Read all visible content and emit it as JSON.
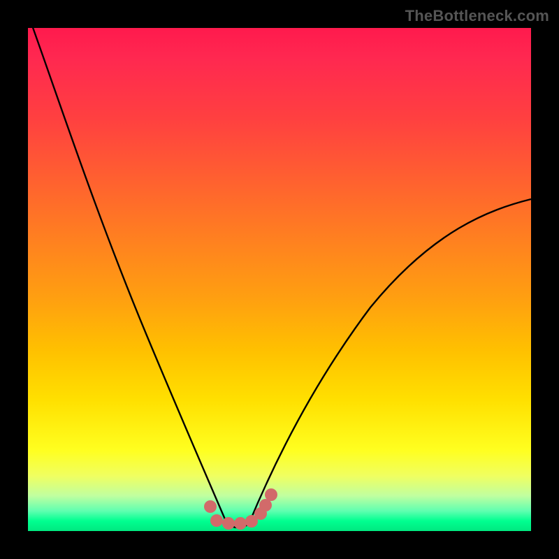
{
  "watermark": "TheBottleneck.com",
  "chart_data": {
    "type": "line",
    "title": "",
    "xlabel": "",
    "ylabel": "",
    "xlim": [
      0,
      100
    ],
    "ylim": [
      0,
      100
    ],
    "series": [
      {
        "name": "curve-left",
        "x": [
          0,
          5,
          10,
          15,
          20,
          25,
          30,
          33,
          36,
          38,
          40
        ],
        "y": [
          100,
          85,
          70,
          56,
          42,
          29,
          17,
          10,
          5,
          2,
          0
        ]
      },
      {
        "name": "curve-right",
        "x": [
          44,
          47,
          50,
          54,
          60,
          68,
          78,
          90,
          100
        ],
        "y": [
          0,
          3,
          7,
          12,
          21,
          33,
          46,
          58,
          66
        ]
      }
    ],
    "markers": {
      "name": "bottom-dots",
      "color": "#d26a6a",
      "points": [
        {
          "x": 36.3,
          "y": 4.8
        },
        {
          "x": 37.5,
          "y": 2.0
        },
        {
          "x": 39.8,
          "y": 1.6
        },
        {
          "x": 42.2,
          "y": 1.6
        },
        {
          "x": 44.4,
          "y": 1.9
        },
        {
          "x": 46.2,
          "y": 3.5
        },
        {
          "x": 47.2,
          "y": 5.2
        },
        {
          "x": 48.3,
          "y": 7.2
        }
      ]
    },
    "gradient_colors": {
      "top": "#ff1a4d",
      "mid": "#ffe000",
      "bottom": "#00e880"
    }
  }
}
